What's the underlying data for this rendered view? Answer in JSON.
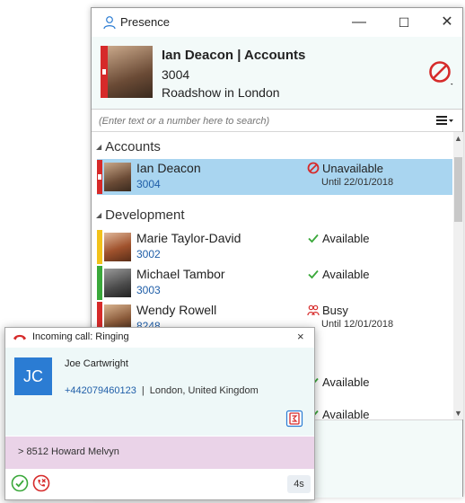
{
  "window": {
    "title": "Presence",
    "minimize": "—",
    "maximize": "☐",
    "close": "✕"
  },
  "header": {
    "name": "Ian Deacon | Accounts",
    "extension": "3004",
    "note": "Roadshow in London",
    "status_icon": "do-not-disturb-icon",
    "status_color": "#d62a2a"
  },
  "search": {
    "placeholder": "(Enter text or a number here to search)",
    "menu_icon": "hamburger-menu-icon"
  },
  "groups": [
    {
      "name": "Accounts",
      "contacts": [
        {
          "name": "Ian Deacon",
          "ext": "3004",
          "status": "Unavailable",
          "sub": "Until 22/01/2018",
          "bar_color": "#d62a2a",
          "status_icon": "unavailable-icon",
          "selected": true
        }
      ]
    },
    {
      "name": "Development",
      "contacts": [
        {
          "name": "Marie Taylor-David",
          "ext": "3002",
          "status": "Available",
          "sub": "",
          "bar_color": "#f2c21b",
          "status_icon": "check-icon"
        },
        {
          "name": "Michael Tambor",
          "ext": "3003",
          "status": "Available",
          "sub": "",
          "bar_color": "#3aa83a",
          "status_icon": "check-icon"
        },
        {
          "name": "Wendy Rowell",
          "ext": "8248",
          "status": "Busy",
          "sub": "Until 12/01/2018",
          "bar_color": "#d62a2a",
          "status_icon": "busy-icon"
        },
        {
          "name": "",
          "ext": "",
          "status": "Available",
          "sub": "",
          "status_icon": "check-icon"
        },
        {
          "name": "",
          "ext": "",
          "status": "Available",
          "sub": "",
          "status_icon": "check-icon"
        }
      ]
    }
  ],
  "popup": {
    "title": "Incoming call: Ringing",
    "close": "×",
    "initials": "JC",
    "caller_name": "Joe Cartwright",
    "caller_number": "+442079460123",
    "separator": "|",
    "caller_location": "London, United Kingdom",
    "route": "> 8512  Howard Melvyn",
    "timer": "4s",
    "colors": {
      "initials_bg": "#2b7cd3",
      "route_bg": "#ead3e8"
    }
  }
}
